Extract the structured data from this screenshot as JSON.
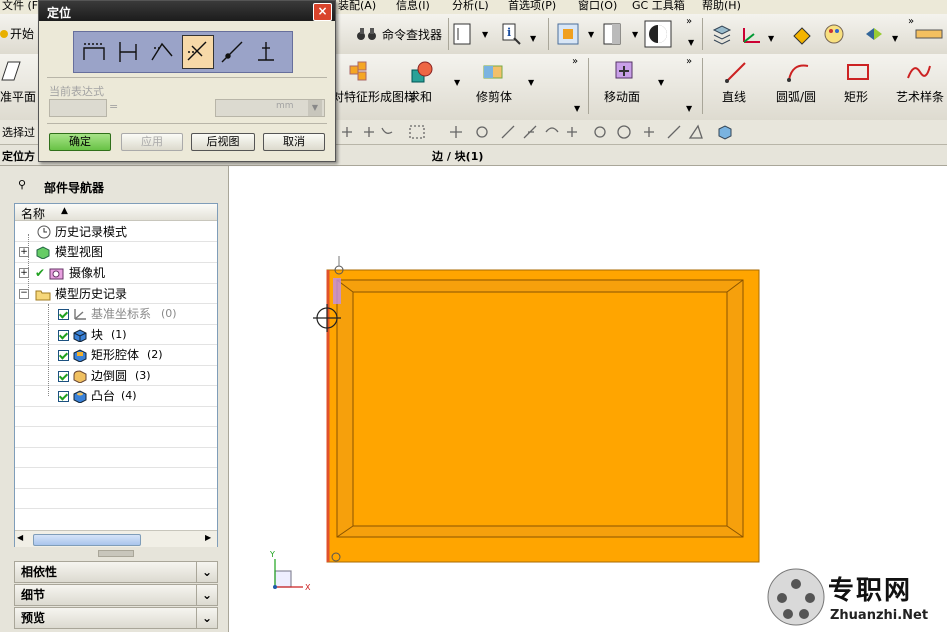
{
  "menu": [
    "文件 (F)",
    "装配(A)",
    "信息(I)",
    "分析(L)",
    "首选项(P)",
    "窗口(O)",
    "GC 工具箱",
    "帮助(H)"
  ],
  "toolbar": {
    "start_label": "开始",
    "command_finder_label": "命令查找器",
    "datum_plane_label": "准平面",
    "feature_pattern_label": "对特征形成图样",
    "unite_label": "求和",
    "trim_body_label": "修剪体",
    "move_face_label": "移动面",
    "line_label": "直线",
    "arc_label": "圆弧/圆",
    "rect_label": "矩形",
    "studio_spline_label": "艺术样条",
    "select_filter_label": "选择过"
  },
  "statusbar": {
    "left_label": "定位方",
    "prompt": "边 / 块(1)"
  },
  "dialog": {
    "title": "定位",
    "close_glyph": "×",
    "expression_label": "当前表达式",
    "equals": "=",
    "unit": "mm",
    "ok_label": "确定",
    "apply_label": "应用",
    "back_label": "后视图",
    "cancel_label": "取消"
  },
  "navigator": {
    "title": "部件导航器",
    "column_name": "名称",
    "items": [
      {
        "label": "历史记录模式"
      },
      {
        "label": "模型视图"
      },
      {
        "label": "摄像机"
      },
      {
        "label": "模型历史记录"
      },
      {
        "label": "基准坐标系",
        "num": "(0)"
      },
      {
        "label": "块",
        "num": "(1)"
      },
      {
        "label": "矩形腔体",
        "num": "(2)"
      },
      {
        "label": "边倒圆",
        "num": "(3)"
      },
      {
        "label": "凸台",
        "num": "(4)"
      }
    ],
    "sections": [
      "相依性",
      "细节",
      "预览"
    ]
  },
  "watermark": {
    "cn": "专职网",
    "url": "Zhuanzhi.Net"
  },
  "colors": {
    "part_orange": "#ffa500",
    "part_edge": "#cc7a00",
    "dialog_title_bg": "#1c1c1c",
    "ok_button": "#7ccd5a"
  }
}
